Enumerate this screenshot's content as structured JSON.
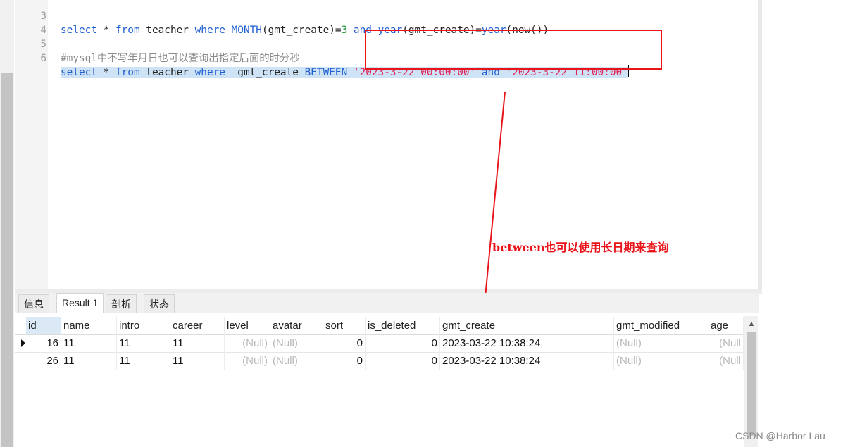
{
  "editor": {
    "lines": [
      {
        "num": "3",
        "code": "select * from teacher where MONTH(gmt_create)=3 and year(gmt_create)=year(now())"
      },
      {
        "num": "4",
        "code": ""
      },
      {
        "num": "5",
        "code": "#mysql中不写年月日也可以查询出指定后面的时分秒"
      },
      {
        "num": "6",
        "code": "select * from teacher where  gmt_create BETWEEN '2023-3-22 00:00:00' and '2023-3-22 11:00:00'"
      }
    ]
  },
  "annotation": {
    "text": "between也可以使用长日期来查询",
    "color": "#e8141a"
  },
  "tabs": [
    {
      "label": "信息"
    },
    {
      "label": "Result 1"
    },
    {
      "label": "剖析"
    },
    {
      "label": "状态"
    }
  ],
  "active_tab": "Result 1",
  "grid": {
    "columns": [
      "id",
      "name",
      "intro",
      "career",
      "level",
      "avatar",
      "sort",
      "is_deleted",
      "gmt_create",
      "gmt_modified",
      "age"
    ],
    "rows": [
      {
        "id": "16",
        "name": "11",
        "intro": "11",
        "career": "11",
        "level": "(Null)",
        "avatar": "(Null)",
        "sort": "0",
        "is_deleted": "0",
        "gmt_create": "2023-03-22 10:38:24",
        "gmt_modified": "(Null)",
        "age": "(Null"
      },
      {
        "id": "26",
        "name": "11",
        "intro": "11",
        "career": "11",
        "level": "(Null)",
        "avatar": "(Null)",
        "sort": "0",
        "is_deleted": "0",
        "gmt_create": "2023-03-22 10:38:24",
        "gmt_modified": "(Null)",
        "age": "(Null"
      }
    ]
  },
  "watermark": "CSDN @Harbor Lau"
}
